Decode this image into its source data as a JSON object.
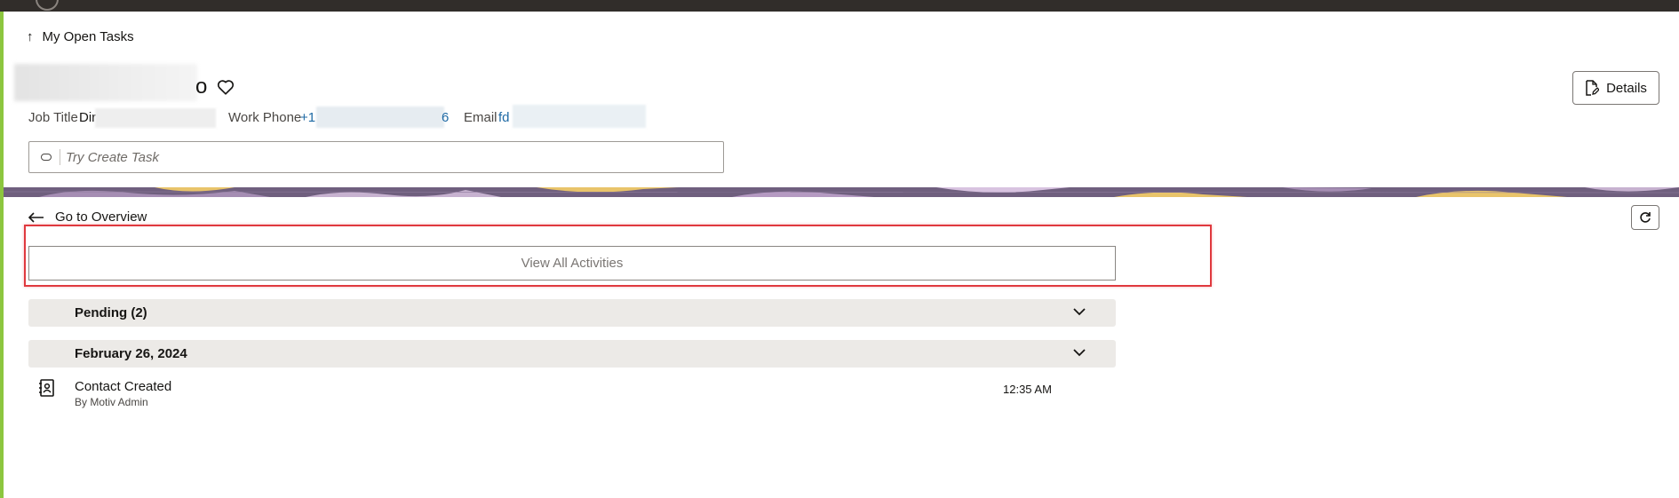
{
  "header": {
    "back_link": "My Open Tasks",
    "name_visible_tail": "o",
    "details_label": "Details"
  },
  "contact": {
    "job_title_label": "Job Title",
    "job_title_value": "Dir",
    "work_phone_label": "Work Phone",
    "work_phone_value_prefix": "+1",
    "work_phone_value_suffix": "6",
    "email_label": "Email",
    "email_value": "fd"
  },
  "task_input": {
    "placeholder": "Try Create Task"
  },
  "activities": {
    "overview_link": "Go to Overview",
    "view_all_label": "View All Activities",
    "groups": [
      {
        "label": "Pending (2)"
      },
      {
        "label": "February 26, 2024"
      }
    ],
    "items": [
      {
        "title": "Contact Created",
        "subtitle": "By Motiv Admin",
        "time": "12:35 AM"
      }
    ]
  },
  "colors": {
    "accent_left": "#8cc63f",
    "topbar": "#312d2a",
    "highlight": "#e0393e",
    "link": "#1f6aa5"
  }
}
